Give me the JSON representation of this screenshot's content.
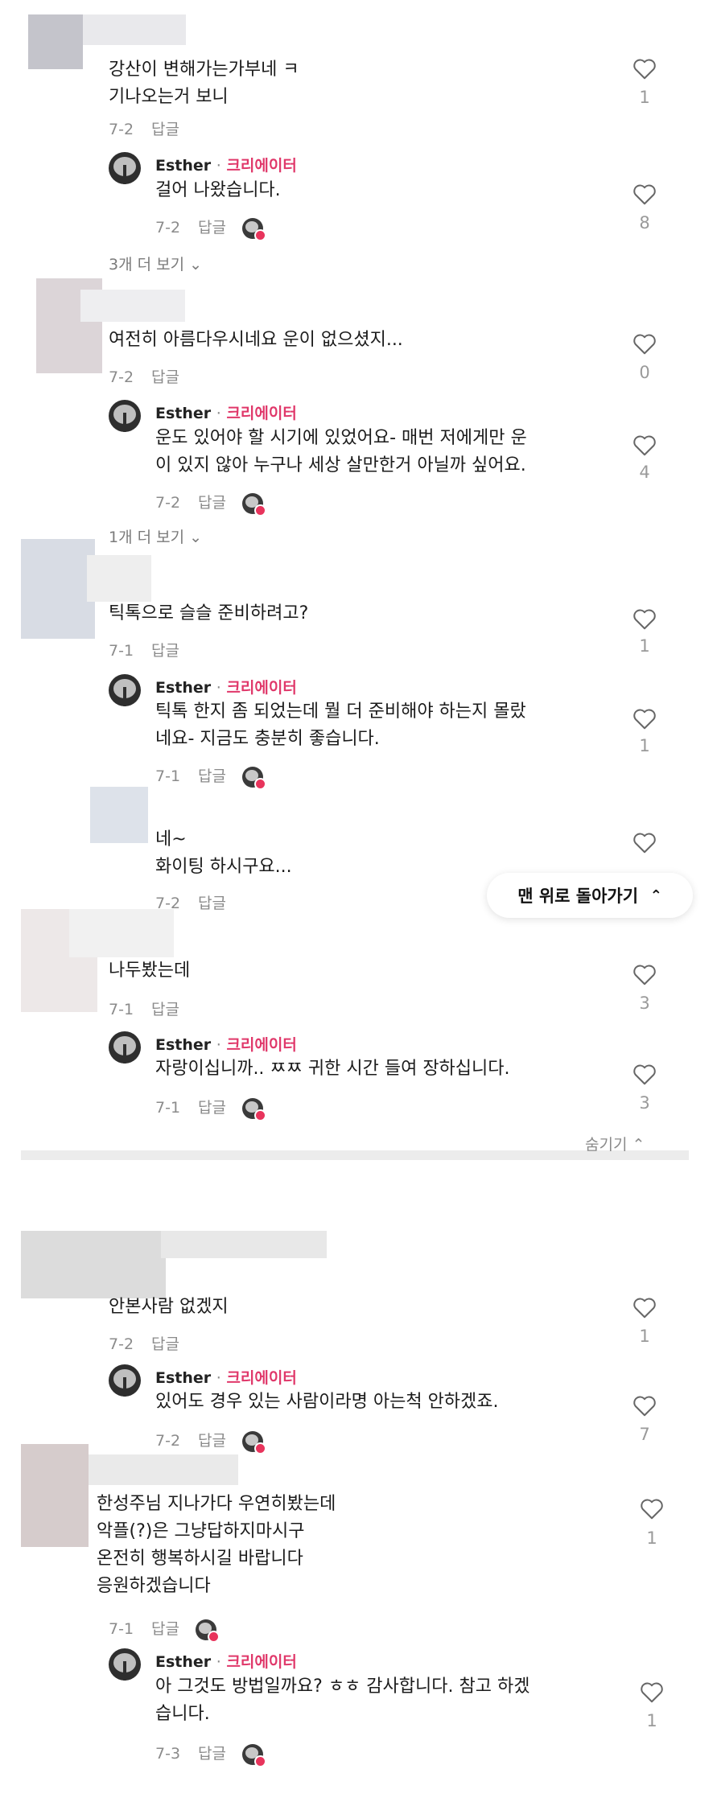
{
  "creator_tag": "크리에이터",
  "reply_label": "답글",
  "threads": [
    {
      "comment": {
        "lines": [
          "강산이 변해가는가부네 ㅋ",
          "기나오는거 보니"
        ],
        "date": "7-2",
        "likes": "1"
      },
      "reply": {
        "name": "Esther",
        "lines": [
          "걸어 나왔습니다."
        ],
        "date": "7-2",
        "likes": "8"
      },
      "more": "3개 더 보기"
    },
    {
      "comment": {
        "lines": [
          "여전히 아름다우시네요 운이 없으셨지..."
        ],
        "date": "7-2",
        "likes": "0"
      },
      "reply": {
        "name": "Esther",
        "lines": [
          "운도 있어야 할 시기에 있었어요- 매번 저에게만 운",
          "이 있지 않아 누구나 세상 살만한거 아닐까 싶어요."
        ],
        "date": "7-2",
        "likes": "4"
      },
      "more": "1개 더 보기"
    },
    {
      "comment": {
        "lines": [
          "틱톡으로 슬슬 준비하려고?"
        ],
        "date": "7-1",
        "likes": "1"
      },
      "reply": {
        "name": "Esther",
        "lines": [
          "틱톡 한지 좀 되었는데 뭘 더 준비해야 하는지 몰랐",
          "네요- 지금도 충분히 좋습니다."
        ],
        "date": "7-1",
        "likes": "1"
      },
      "sub": {
        "lines": [
          "네~",
          "화이팅 하시구요..."
        ],
        "date": "7-2"
      }
    },
    {
      "comment": {
        "lines": [
          "나두봤는데"
        ],
        "date": "7-1",
        "likes": "3"
      },
      "reply": {
        "name": "Esther",
        "lines": [
          "자랑이십니까.. ㅉㅉ 귀한 시간 들여 장하십니다."
        ],
        "date": "7-1",
        "likes": "3"
      },
      "hide": "숨기기"
    },
    {
      "comment": {
        "lines": [
          "안본사람 없겠지"
        ],
        "date": "7-2",
        "likes": "1"
      },
      "reply": {
        "name": "Esther",
        "lines": [
          "있어도 경우 있는 사람이라명 아는척 안하겠죠."
        ],
        "date": "7-2",
        "likes": "7"
      }
    },
    {
      "comment": {
        "lines": [
          "한성주님 지나가다 우연히봤는데",
          "악플(?)은 그냥답하지마시구",
          "온전히 행복하시길 바랍니다",
          "응원하겠습니다"
        ],
        "date": "7-1",
        "likes": "1"
      },
      "reply": {
        "name": "Esther",
        "lines": [
          "아 그것도 방법일까요? ㅎㅎ 감사합니다. 참고 하겠",
          "습니다."
        ],
        "date": "7-3",
        "likes": "1"
      }
    }
  ],
  "back_to_top": "맨 위로 돌아가기",
  "icons": {
    "like": "heart-outline-icon",
    "chevron": "chevron-down-icon",
    "up": "double-chevron-up-icon"
  },
  "colors": {
    "creator": "#e0386a",
    "meta": "#8b8b8b"
  }
}
